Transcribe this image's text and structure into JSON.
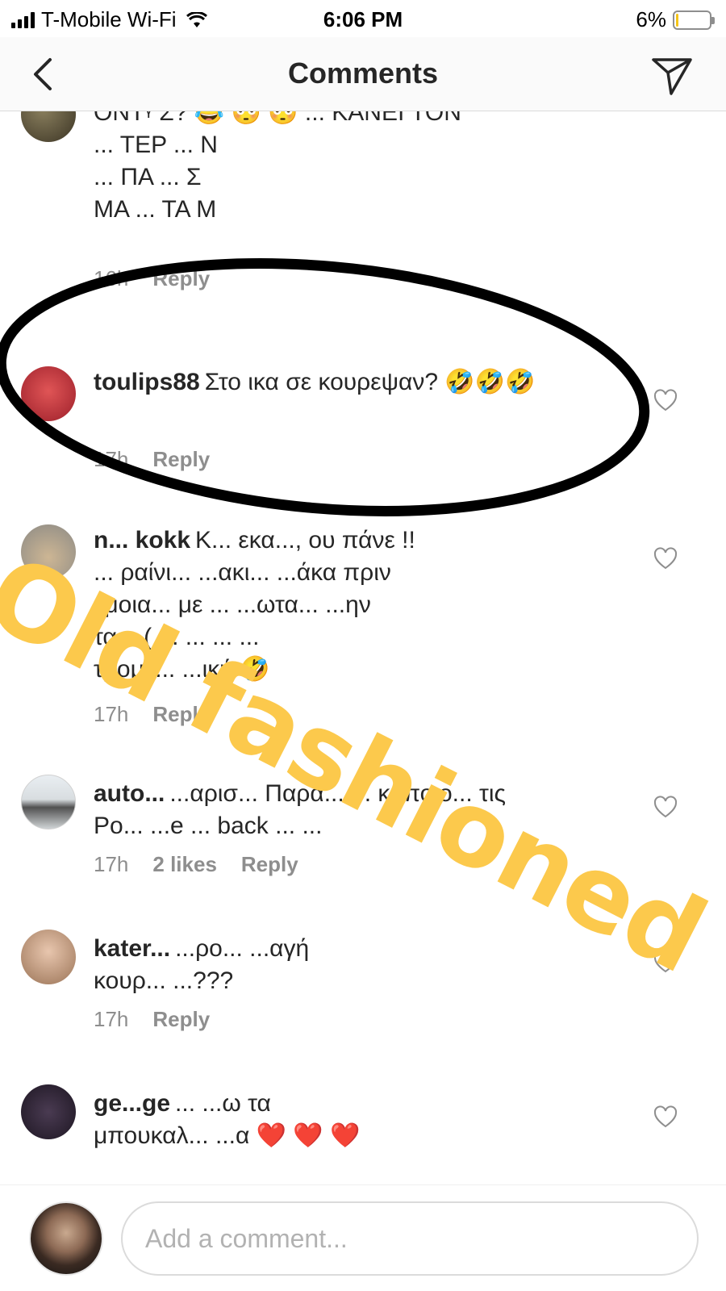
{
  "status_bar": {
    "carrier": "T-Mobile Wi-Fi",
    "time": "6:06 PM",
    "battery_percent": "6%",
    "battery_level": 0.06,
    "battery_color": "#f5c518",
    "icons": [
      "signal-icon",
      "wifi-icon",
      "battery-icon"
    ]
  },
  "header": {
    "title": "Comments",
    "back_icon": "chevron-left-icon",
    "share_icon": "paper-plane-icon"
  },
  "comments": [
    {
      "lines": [
        "ONTᵞ Σ? 😂 😳 😳 ... ΚΑΝΕΙ ΤΟΝ",
        "... ΤΕΡ ... Ν",
        "... ΠΑ ... Σ",
        "ΜΑ ... ΤΑ Μ"
      ],
      "time": "16h",
      "reply": "Reply"
    },
    {
      "username": "toulips88",
      "text": "Στο ικα σε κουρεψαν? 🤣🤣🤣",
      "time": "17h",
      "reply": "Reply"
    },
    {
      "username": "n... kokk",
      "text": "Κ... εκα..., ου πάνε !!",
      "lines2": [
        "... ραίνι... ...ακι... ...άκα πριν",
        "εμοια... με ... ...ωτα... ...ην",
        "τα... ( ... ... ... ...",
        "τρομε... ...ική 🤣"
      ],
      "time": "17h",
      "reply": "Reply"
    },
    {
      "username": "auto...",
      "text": "...αρισ... Παρα... ... κάποιο... τις",
      "line2": "Po... ...e ... back ... ...",
      "time": "17h",
      "likes": "2 likes",
      "reply": "Reply"
    },
    {
      "username": "kater...",
      "text": "...ρο... ...αγή",
      "line2": "κουρ... ...???",
      "time": "17h",
      "reply": "Reply"
    },
    {
      "username": "ge...ge",
      "text": "... ...ω τα",
      "line2": "μπουκαλ... ...α ❤️ ❤️ ❤️"
    }
  ],
  "overlay": {
    "sticker_text": "Old fashioned",
    "sticker_color": "#fcc94c",
    "ellipse_color": "#000000"
  },
  "composer": {
    "placeholder": "Add a comment..."
  }
}
